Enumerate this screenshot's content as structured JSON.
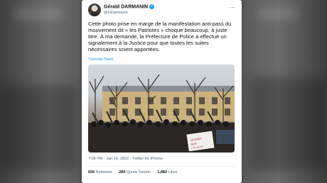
{
  "tweet": {
    "author_name": "Gérald DARMANIN",
    "handle": "@GDarmanin",
    "more_icon": "more-horizontal-icon",
    "text": "Cette photo prise en marge de la manifestation anti-pass du mouvement dit « les Patriotes » choque beaucoup, à juste titre. À ma demande, la Préfecture de Police a effectué un signalement à la Justice pour que toutes les suites nécessaires soient apportées.",
    "translate_label": "Translate Tweet",
    "timestamp": "7:09 PM · Jan 16, 2022 · Twitter for iPhone",
    "stats": {
      "retweets_count": "656",
      "retweets_label": "Retweets",
      "quotes_count": "284",
      "quotes_label": "Quote Tweets",
      "likes_count": "1,882",
      "likes_label": "Likes"
    },
    "photo": {
      "banner_text": "LEVONS SUR L'ALLIANCE"
    }
  },
  "colors": {
    "accent": "#1d9bf0",
    "text": "#0f1419",
    "muted": "#536471"
  }
}
